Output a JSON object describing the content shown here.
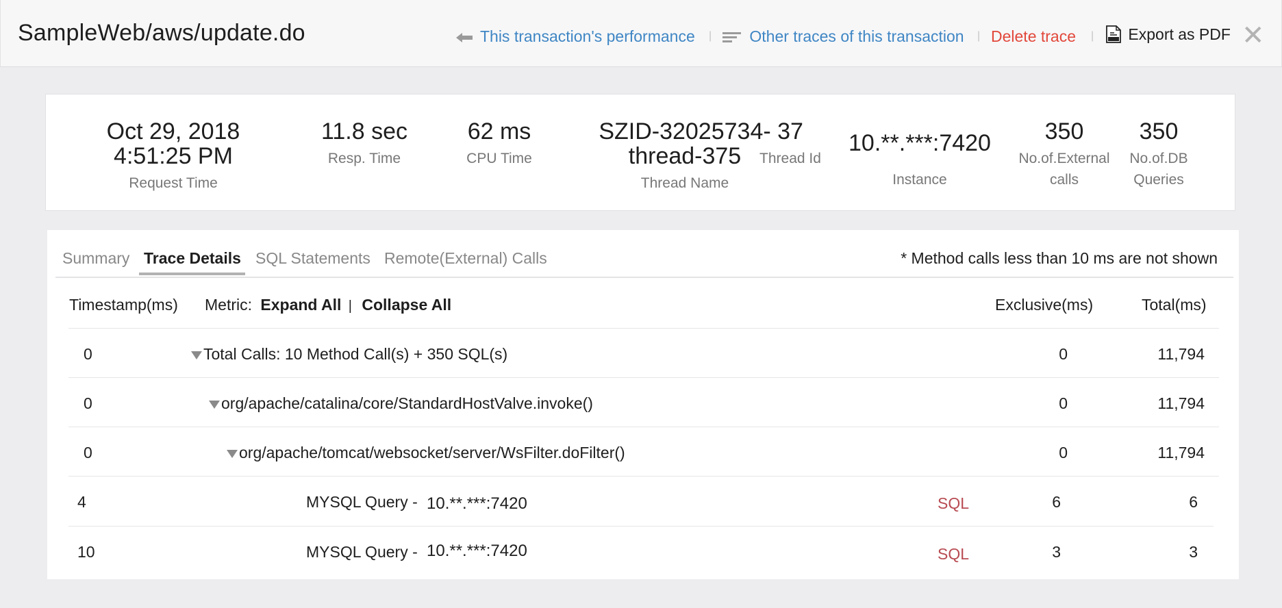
{
  "header": {
    "title": "SampleWeb/aws/update.do",
    "links": {
      "performance": "This transaction's performance",
      "other_traces": "Other traces of this transaction",
      "delete": "Delete trace",
      "export": "Export as PDF"
    },
    "separator": "|",
    "close": "✕"
  },
  "stats": {
    "request_time": {
      "value_line1": "Oct 29, 2018",
      "value_line2": "4:51:25 PM",
      "label": "Request Time"
    },
    "resp_time": {
      "value": "11.8 sec",
      "label": "Resp. Time"
    },
    "cpu_time": {
      "value": "62 ms",
      "label": "CPU Time"
    },
    "thread_name": {
      "value_line1": "SZID-32025734-",
      "value_line2": "thread-375",
      "label": "Thread Name"
    },
    "thread_id": {
      "value": "37",
      "label": "Thread Id"
    },
    "instance": {
      "value": "10.**.***:7420",
      "label": "Instance"
    },
    "external_calls": {
      "value": "350",
      "label_line1": "No.of.External",
      "label_line2": "calls"
    },
    "db_queries": {
      "value": "350",
      "label_line1": "No.of.DB",
      "label_line2": "Queries"
    }
  },
  "tabs": [
    {
      "label": "Summary",
      "active": false
    },
    {
      "label": "Trace Details",
      "active": true
    },
    {
      "label": "SQL Statements",
      "active": false
    },
    {
      "label": "Remote(External) Calls",
      "active": false
    }
  ],
  "note": "* Method calls less than 10 ms are not shown",
  "table": {
    "headers": {
      "timestamp": "Timestamp(ms)",
      "metric": "Metric:",
      "expand_all": "Expand All",
      "divider": "|",
      "collapse_all": "Collapse All",
      "exclusive": "Exclusive(ms)",
      "total": "Total(ms)"
    },
    "rows": [
      {
        "timestamp": "0",
        "metric": "Total Calls: 10 Method Call(s) + 350 SQL(s)",
        "exclusive": "0",
        "total": "11,794"
      },
      {
        "timestamp": "0",
        "metric": "org/apache/catalina/core/StandardHostValve.invoke()",
        "exclusive": "0",
        "total": "11,794"
      },
      {
        "timestamp": "0",
        "metric": "org/apache/tomcat/websocket/server/WsFilter.doFilter()",
        "exclusive": "0",
        "total": "11,794"
      },
      {
        "timestamp": "4",
        "metric": "MYSQL Query -",
        "host": "10.**.***:7420",
        "type": "SQL",
        "exclusive": "6",
        "total": "6"
      },
      {
        "timestamp": "10",
        "metric": "MYSQL Query -",
        "host": "10.**.***:7420",
        "type": "SQL",
        "exclusive": "3",
        "total": "3"
      }
    ]
  }
}
